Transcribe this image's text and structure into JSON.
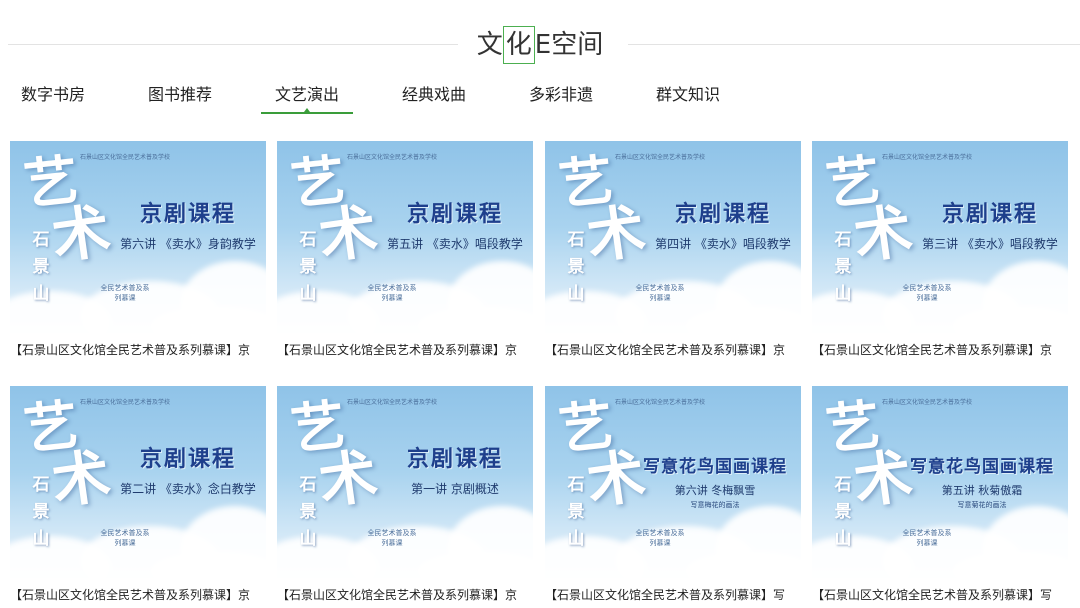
{
  "header": {
    "title_prefix": "文",
    "title_highlight": "化",
    "title_suffix": "E空间"
  },
  "tabs": [
    {
      "label": "数字书房",
      "active": false
    },
    {
      "label": "图书推荐",
      "active": false
    },
    {
      "label": "文艺演出",
      "active": true
    },
    {
      "label": "经典戏曲",
      "active": false
    },
    {
      "label": "多彩非遗",
      "active": false
    },
    {
      "label": "群文知识",
      "active": false
    }
  ],
  "thumb_common": {
    "big1": "艺",
    "big2": "术",
    "vertical": "石景山",
    "top_small": "石景山区文化馆全民艺术普及学校",
    "side_small": "全民艺术普及系列慕课"
  },
  "cards": [
    {
      "course": "京剧课程",
      "lecture": "第六讲 《卖水》身韵教学",
      "sub": "",
      "caption": "【石景山区文化馆全民艺术普及系列慕课】京"
    },
    {
      "course": "京剧课程",
      "lecture": "第五讲 《卖水》唱段教学",
      "sub": "",
      "caption": "【石景山区文化馆全民艺术普及系列慕课】京"
    },
    {
      "course": "京剧课程",
      "lecture": "第四讲 《卖水》唱段教学",
      "sub": "",
      "caption": "【石景山区文化馆全民艺术普及系列慕课】京"
    },
    {
      "course": "京剧课程",
      "lecture": "第三讲 《卖水》唱段教学",
      "sub": "",
      "caption": "【石景山区文化馆全民艺术普及系列慕课】京"
    },
    {
      "course": "京剧课程",
      "lecture": "第二讲 《卖水》念白教学",
      "sub": "",
      "caption": "【石景山区文化馆全民艺术普及系列慕课】京"
    },
    {
      "course": "京剧课程",
      "lecture": "第一讲 京剧概述",
      "sub": "",
      "caption": "【石景山区文化馆全民艺术普及系列慕课】京"
    },
    {
      "course": "写意花鸟国画课程",
      "lecture": "第六讲 冬梅飘雪",
      "sub": "写意梅花的画法",
      "caption": "【石景山区文化馆全民艺术普及系列慕课】写"
    },
    {
      "course": "写意花鸟国画课程",
      "lecture": "第五讲 秋菊傲霜",
      "sub": "写意菊花的画法",
      "caption": "【石景山区文化馆全民艺术普及系列慕课】写"
    }
  ]
}
